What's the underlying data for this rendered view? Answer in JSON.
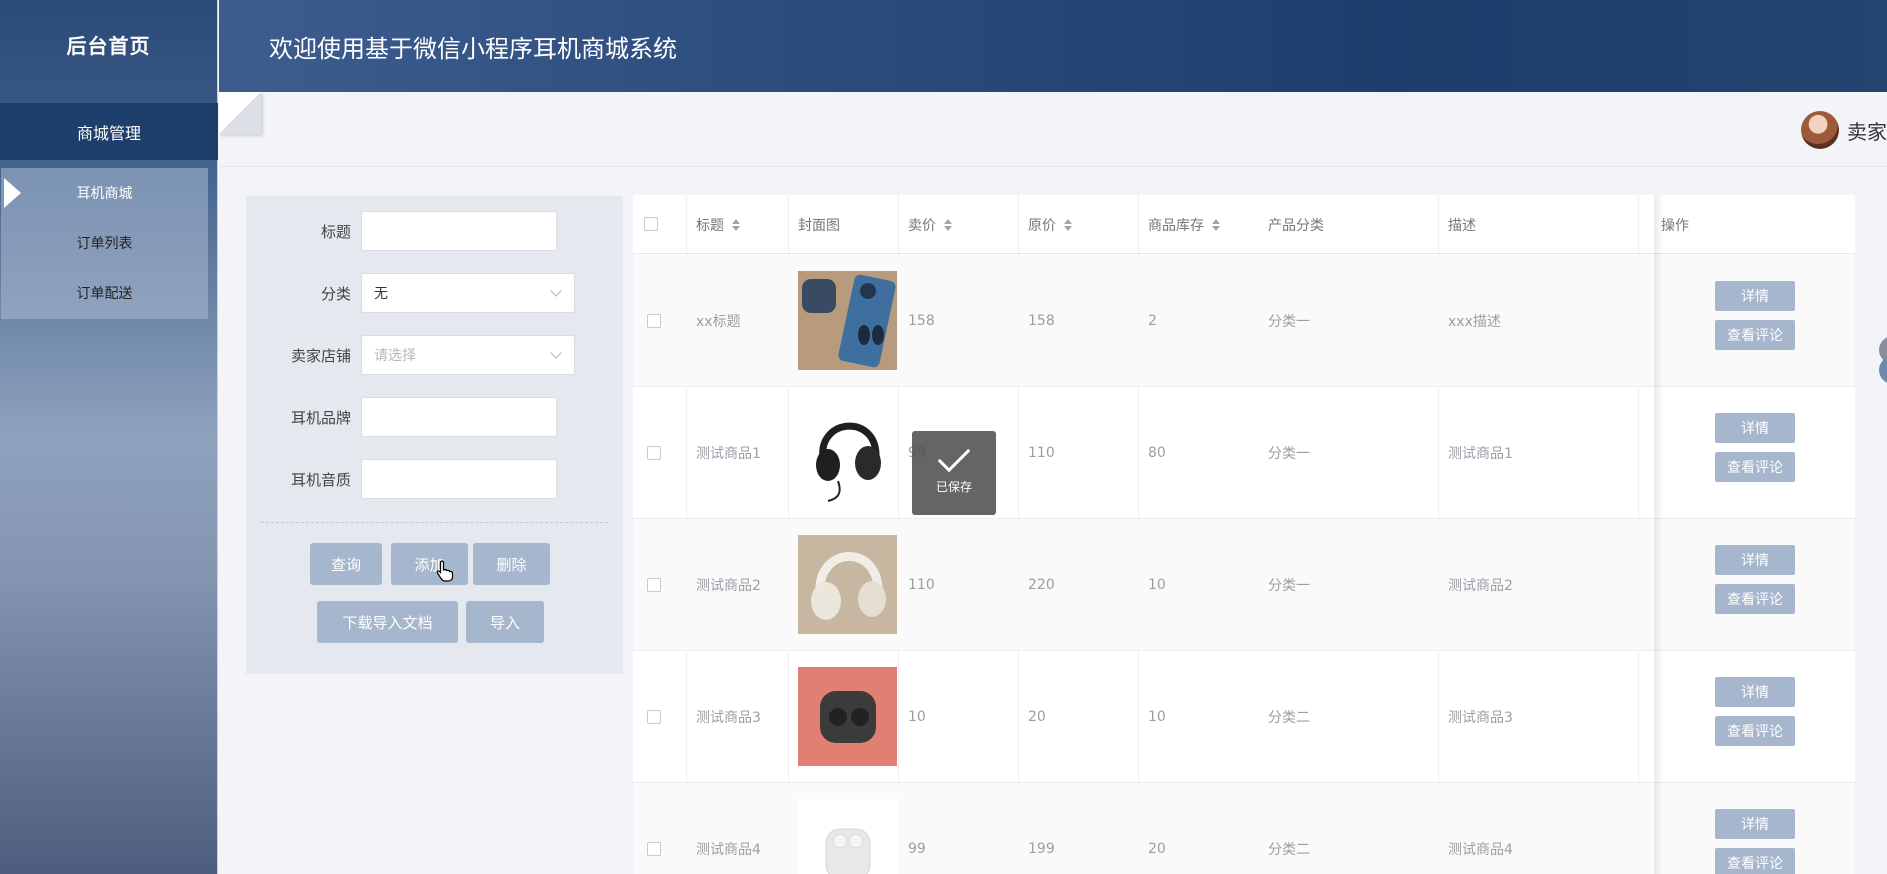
{
  "sidebar": {
    "brand": "后台首页",
    "menu_head": "商城管理",
    "items": [
      {
        "label": "耳机商城",
        "active": true
      },
      {
        "label": "订单列表",
        "active": false
      },
      {
        "label": "订单配送",
        "active": false
      }
    ]
  },
  "header": {
    "title": "欢迎使用基于微信小程序耳机商城系统"
  },
  "user": {
    "name": "卖家",
    "avatar": "user-avatar"
  },
  "filter": {
    "title_label": "标题",
    "title_value": "",
    "category_label": "分类",
    "category_value": "无",
    "shop_label": "卖家店铺",
    "shop_placeholder": "请选择",
    "brand_label": "耳机品牌",
    "brand_value": "",
    "quality_label": "耳机音质",
    "quality_value": "",
    "buttons": {
      "query": "查询",
      "add": "添加",
      "delete": "删除",
      "download": "下载导入文档",
      "import": "导入"
    }
  },
  "table": {
    "columns": [
      "标题",
      "封面图",
      "卖价",
      "原价",
      "商品库存",
      "产品分类",
      "描述",
      "操作"
    ],
    "rows": [
      {
        "title": "xx标题",
        "price": "158",
        "orig": "158",
        "stock": "2",
        "category": "分类一",
        "desc": "xxx描述",
        "img": "earbuds-phone-image"
      },
      {
        "title": "测试商品1",
        "price": "99",
        "orig": "110",
        "stock": "80",
        "category": "分类一",
        "desc": "测试商品1",
        "img": "black-headphones-image"
      },
      {
        "title": "测试商品2",
        "price": "110",
        "orig": "220",
        "stock": "10",
        "category": "分类一",
        "desc": "测试商品2",
        "img": "white-headphones-image"
      },
      {
        "title": "测试商品3",
        "price": "10",
        "orig": "20",
        "stock": "10",
        "category": "分类二",
        "desc": "测试商品3",
        "img": "earbuds-case-image"
      },
      {
        "title": "测试商品4",
        "price": "99",
        "orig": "199",
        "stock": "20",
        "category": "分类二",
        "desc": "测试商品4",
        "img": "white-earbuds-image"
      }
    ],
    "op_detail": "详情",
    "op_review": "查看评论"
  },
  "toast": {
    "text": "已保存"
  },
  "colors": {
    "accent": "#1e3f6b",
    "button": "#a6b6cc",
    "header": "#2c4c7d"
  }
}
